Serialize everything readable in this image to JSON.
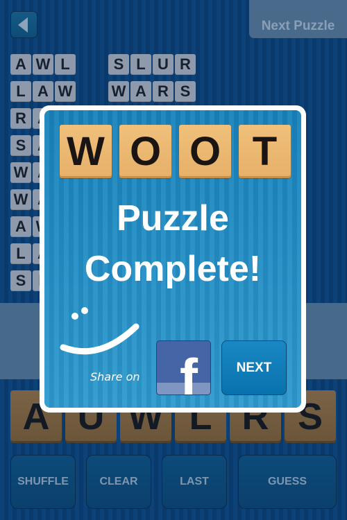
{
  "header": {
    "back_icon": "back-arrow-icon",
    "next_puzzle_label": "Next Puzzle"
  },
  "found_words": [
    {
      "letters": [
        "A",
        "W",
        "L"
      ]
    },
    {
      "letters": [
        "L",
        "A",
        "W"
      ]
    },
    {
      "letters": [
        "R",
        "A"
      ]
    },
    {
      "letters": [
        "S",
        "A"
      ]
    },
    {
      "letters": [
        "W",
        "A"
      ]
    },
    {
      "letters": [
        "W",
        "A"
      ]
    },
    {
      "letters": [
        "A",
        "W"
      ]
    },
    {
      "letters": [
        "L",
        "A"
      ]
    },
    {
      "letters": [
        "S",
        "L"
      ]
    },
    {
      "letters": [
        "S",
        "L",
        "U",
        "R"
      ]
    },
    {
      "letters": [
        "W",
        "A",
        "R",
        "S"
      ]
    }
  ],
  "rack_letters": [
    "A",
    "U",
    "W",
    "L",
    "R",
    "S"
  ],
  "actions": {
    "shuffle": "SHUFFLE",
    "clear": "CLEAR",
    "last": "LAST",
    "guess": "GUESS"
  },
  "modal": {
    "word_tiles": [
      "W",
      "O",
      "O",
      "T"
    ],
    "title_line1": "Puzzle",
    "title_line2": "Complete!",
    "share_label": "Share on",
    "facebook_letter": "f",
    "next_label": "NEXT"
  },
  "colors": {
    "background": "#0b3e72",
    "modal_blue": "#1f8fc6",
    "tile_wood": "#e6b069",
    "facebook_blue": "#4565a6"
  }
}
